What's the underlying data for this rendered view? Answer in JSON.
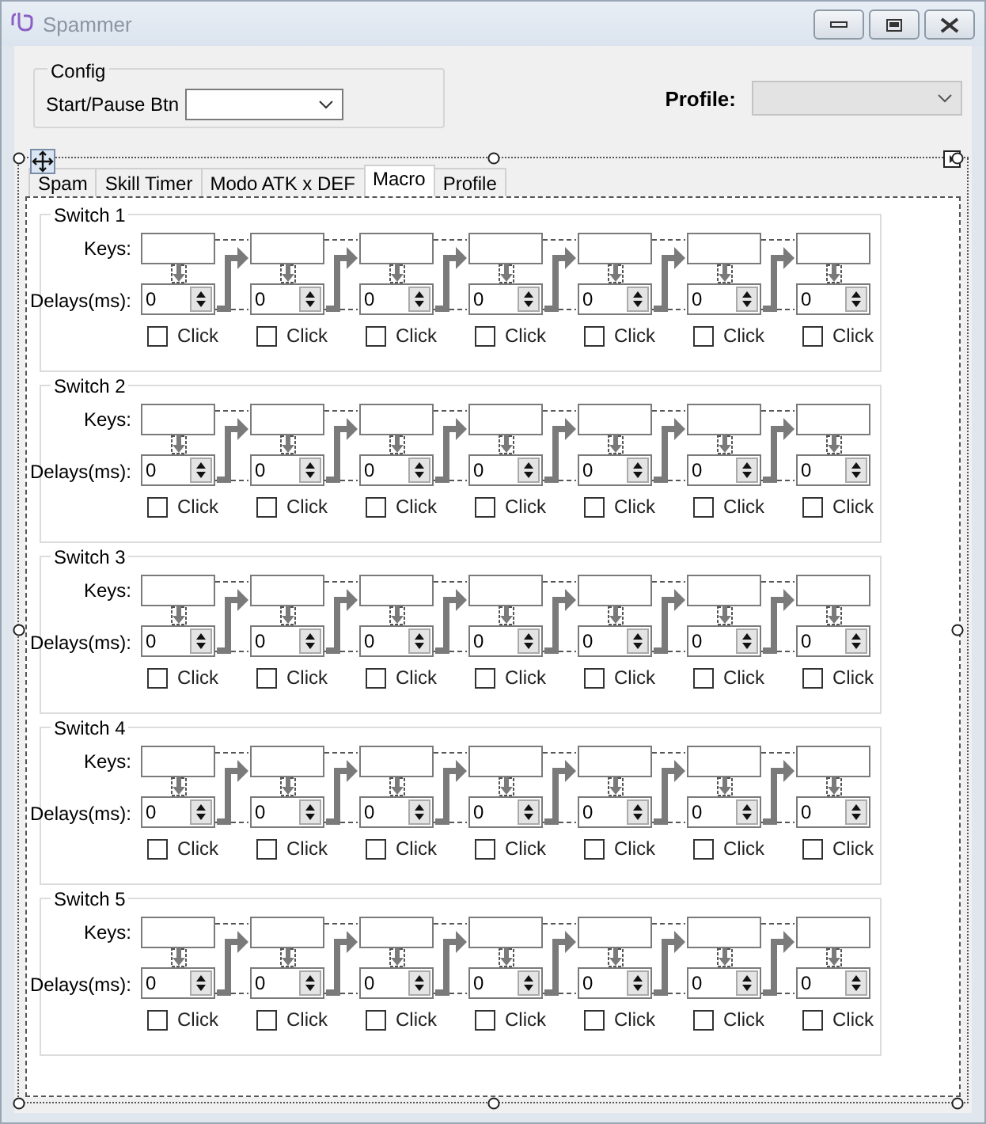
{
  "window": {
    "title": "Spammer"
  },
  "config": {
    "title": "Config",
    "start_pause_label": "Start/Pause Btn"
  },
  "profile": {
    "label": "Profile:",
    "disabled": true
  },
  "tabs": [
    {
      "label": "Spam",
      "selected": false
    },
    {
      "label": "Skill Timer",
      "selected": false
    },
    {
      "label": "Modo ATK x DEF",
      "selected": false
    },
    {
      "label": "Macro",
      "selected": true
    },
    {
      "label": "Profile",
      "selected": false
    }
  ],
  "switches": [
    {
      "title": "Switch 1",
      "keys_label": "Keys:",
      "delays_label": "Delays(ms):",
      "steps": [
        {
          "delay": "0",
          "click": "Click",
          "checked": false
        },
        {
          "delay": "0",
          "click": "Click",
          "checked": false
        },
        {
          "delay": "0",
          "click": "Click",
          "checked": false
        },
        {
          "delay": "0",
          "click": "Click",
          "checked": false
        },
        {
          "delay": "0",
          "click": "Click",
          "checked": false
        },
        {
          "delay": "0",
          "click": "Click",
          "checked": false
        },
        {
          "delay": "0",
          "click": "Click",
          "checked": false
        }
      ]
    },
    {
      "title": "Switch 2",
      "keys_label": "Keys:",
      "delays_label": "Delays(ms):",
      "steps": [
        {
          "delay": "0",
          "click": "Click",
          "checked": false
        },
        {
          "delay": "0",
          "click": "Click",
          "checked": false
        },
        {
          "delay": "0",
          "click": "Click",
          "checked": false
        },
        {
          "delay": "0",
          "click": "Click",
          "checked": false
        },
        {
          "delay": "0",
          "click": "Click",
          "checked": false
        },
        {
          "delay": "0",
          "click": "Click",
          "checked": false
        },
        {
          "delay": "0",
          "click": "Click",
          "checked": false
        }
      ]
    },
    {
      "title": "Switch 3",
      "keys_label": "Keys:",
      "delays_label": "Delays(ms):",
      "steps": [
        {
          "delay": "0",
          "click": "Click",
          "checked": false
        },
        {
          "delay": "0",
          "click": "Click",
          "checked": false
        },
        {
          "delay": "0",
          "click": "Click",
          "checked": false
        },
        {
          "delay": "0",
          "click": "Click",
          "checked": false
        },
        {
          "delay": "0",
          "click": "Click",
          "checked": false
        },
        {
          "delay": "0",
          "click": "Click",
          "checked": false
        },
        {
          "delay": "0",
          "click": "Click",
          "checked": false
        }
      ]
    },
    {
      "title": "Switch 4",
      "keys_label": "Keys:",
      "delays_label": "Delays(ms):",
      "steps": [
        {
          "delay": "0",
          "click": "Click",
          "checked": false
        },
        {
          "delay": "0",
          "click": "Click",
          "checked": false
        },
        {
          "delay": "0",
          "click": "Click",
          "checked": false
        },
        {
          "delay": "0",
          "click": "Click",
          "checked": false
        },
        {
          "delay": "0",
          "click": "Click",
          "checked": false
        },
        {
          "delay": "0",
          "click": "Click",
          "checked": false
        },
        {
          "delay": "0",
          "click": "Click",
          "checked": false
        }
      ]
    },
    {
      "title": "Switch 5",
      "keys_label": "Keys:",
      "delays_label": "Delays(ms):",
      "steps": [
        {
          "delay": "0",
          "click": "Click",
          "checked": false
        },
        {
          "delay": "0",
          "click": "Click",
          "checked": false
        },
        {
          "delay": "0",
          "click": "Click",
          "checked": false
        },
        {
          "delay": "0",
          "click": "Click",
          "checked": false
        },
        {
          "delay": "0",
          "click": "Click",
          "checked": false
        },
        {
          "delay": "0",
          "click": "Click",
          "checked": false
        },
        {
          "delay": "0",
          "click": "Click",
          "checked": false
        }
      ]
    }
  ]
}
